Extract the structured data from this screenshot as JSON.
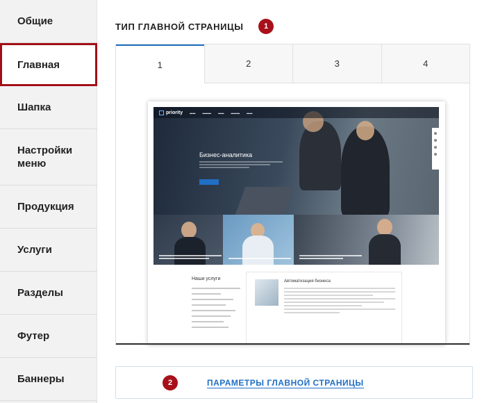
{
  "sidebar": {
    "items": [
      {
        "label": "Общие"
      },
      {
        "label": "Главная",
        "active": true
      },
      {
        "label": "Шапка"
      },
      {
        "label": "Настройки\nменю"
      },
      {
        "label": "Продукция"
      },
      {
        "label": "Услуги"
      },
      {
        "label": "Разделы"
      },
      {
        "label": "Футер"
      },
      {
        "label": "Баннеры"
      }
    ]
  },
  "main": {
    "section_title": "ТИП ГЛАВНОЙ СТРАНИЦЫ",
    "badge_1": "1",
    "tabs": [
      {
        "label": "1",
        "active": true
      },
      {
        "label": "2"
      },
      {
        "label": "3"
      },
      {
        "label": "4"
      }
    ],
    "preview": {
      "logo": "priority",
      "hero_title": "Бизнес-аналитика",
      "services_title": "Наши услуги",
      "service_card_title": "Автоматизация бизнеса"
    },
    "expand_icon": "chevron-down-icon",
    "badge_2": "2",
    "params_link": "ПАРАМЕТРЫ ГЛАВНОЙ СТРАНИЦЫ"
  },
  "colors": {
    "accent_red": "#a8101a",
    "accent_blue": "#1f6fc5",
    "sidebar_bg": "#f2f2f2"
  }
}
